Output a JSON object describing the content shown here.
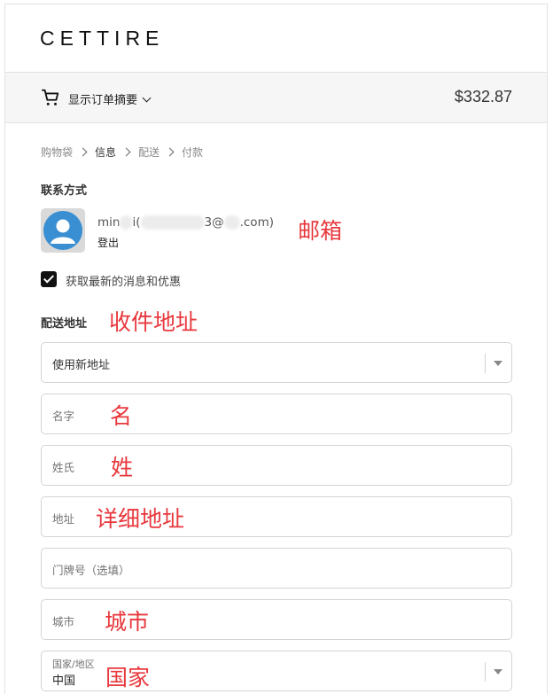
{
  "header": {
    "logo": "CETTIRE"
  },
  "summary": {
    "toggle_label": "显示订单摘要",
    "total": "$332.87"
  },
  "breadcrumb": {
    "items": [
      "购物袋",
      "信息",
      "配送",
      "付款"
    ]
  },
  "contact": {
    "title": "联系方式",
    "email_start": "min",
    "email_mid1": "i(",
    "email_mid2": "3@",
    "email_end": ".com)",
    "logout": "登出",
    "annotation": "邮箱"
  },
  "newsletter": {
    "label": "获取最新的消息和优惠",
    "checked": true
  },
  "shipping": {
    "title": "配送地址",
    "annotation": "收件地址",
    "saved_address": "使用新地址",
    "fields": {
      "first_name": {
        "placeholder": "名字",
        "annotation": "名"
      },
      "last_name": {
        "placeholder": "姓氏",
        "annotation": "姓"
      },
      "address": {
        "placeholder": "地址",
        "annotation": "详细地址"
      },
      "apartment": {
        "placeholder": "门牌号（选填）"
      },
      "city": {
        "placeholder": "城市",
        "annotation": "城市"
      },
      "country": {
        "label": "国家/地区",
        "value": "中国",
        "annotation": "国家"
      }
    }
  },
  "colors": {
    "annotation": "#e8383d",
    "accent": "#111111"
  }
}
